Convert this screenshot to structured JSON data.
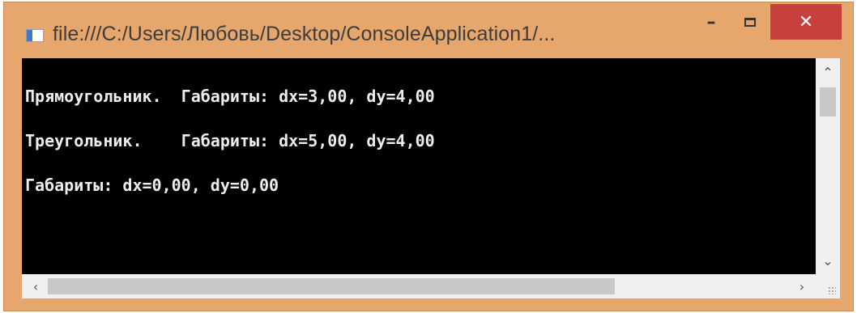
{
  "window": {
    "title": "file:///C:/Users/Любовь/Desktop/ConsoleApplication1/...",
    "icons": {
      "app": "console-app-icon",
      "minimize": "minimize-icon",
      "maximize": "maximize-icon",
      "close": "close-icon"
    },
    "minimize_glyph": "–",
    "close_glyph": "✕"
  },
  "console": {
    "lines": [
      "Прямоугольник.  Габариты: dx=3,00, dy=4,00",
      "Треугольник.    Габариты: dx=5,00, dy=4,00",
      "Габариты: dx=0,00, dy=0,00"
    ]
  },
  "scrollbars": {
    "vertical": {
      "up_glyph": "⌃",
      "down_glyph": "⌄"
    },
    "horizontal": {
      "left_glyph": "‹",
      "right_glyph": "›"
    }
  },
  "colors": {
    "frame": "#e7a66b",
    "close_button": "#c8403c",
    "console_bg": "#000000",
    "console_text": "#ededed"
  }
}
